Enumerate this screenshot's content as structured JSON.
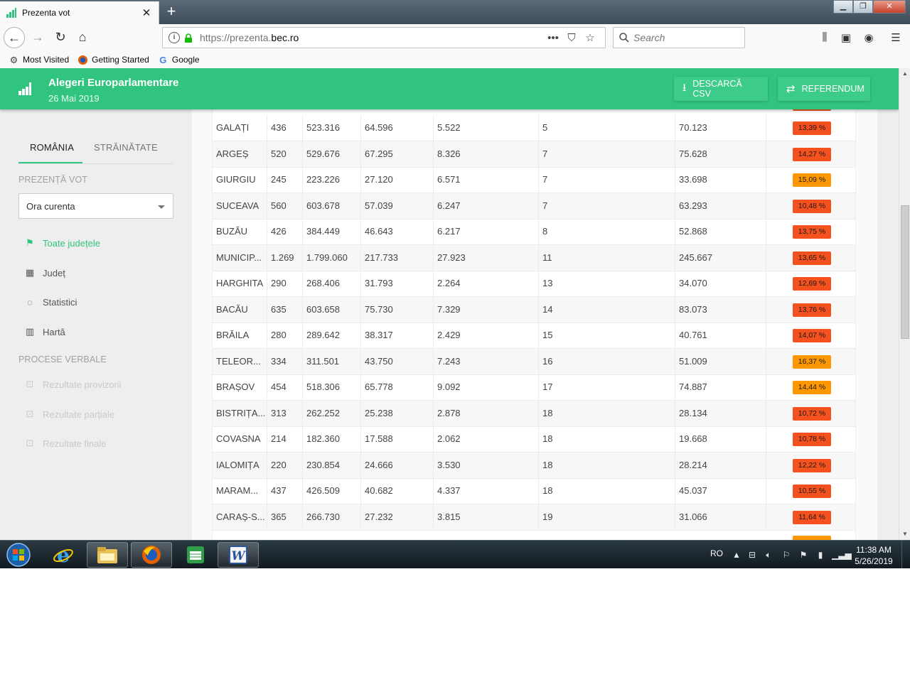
{
  "browser": {
    "tab_title": "Prezenta vot",
    "tab_close": "✕",
    "new_tab": "+",
    "url_prefix": "https://prezenta.",
    "url_domain": "bec.ro",
    "search_placeholder": "Search"
  },
  "bookmarks": [
    {
      "label": "Most Visited",
      "icon": "gear-icon"
    },
    {
      "label": "Getting Started",
      "icon": "firefox-icon"
    },
    {
      "label": "Google",
      "icon": "google-icon"
    }
  ],
  "app": {
    "title": "Alegeri Europarlamentare",
    "date": "26 Mai 2019",
    "csv_label": "DESCARCĂ CSV",
    "referendum_label": "REFERENDUM",
    "accent_color": "#31c47f"
  },
  "sidebar": {
    "tab_romania": "ROMÂNIA",
    "tab_strainatate": "STRĂINĂTATE",
    "heading_prezenta": "PREZENȚĂ VOT",
    "select_value": "Ora curenta",
    "items": [
      {
        "label": "Toate județele",
        "icon": "flag-icon",
        "state": "active"
      },
      {
        "label": "Județ",
        "icon": "building-icon",
        "state": "normal"
      },
      {
        "label": "Statistici",
        "icon": "donut-chart-icon",
        "state": "normal"
      },
      {
        "label": "Hartă",
        "icon": "map-icon",
        "state": "normal"
      }
    ],
    "heading_procese": "PROCESE VERBALE",
    "results": [
      {
        "label": "Rezultate provizorii",
        "icon": "document-1-icon",
        "state": "disabled"
      },
      {
        "label": "Rezultate parțiale",
        "icon": "document-2-icon",
        "state": "disabled"
      },
      {
        "label": "Rezultate finale",
        "icon": "document-3-icon",
        "state": "disabled"
      }
    ]
  },
  "table": {
    "rows": [
      {
        "judet": "GALAȚI",
        "c1": "436",
        "c2": "523.316",
        "c3": "64.596",
        "c4": "5.522",
        "c5": "5",
        "c6": "70.123",
        "pct": "13,39 %",
        "level": "red"
      },
      {
        "judet": "ARGEȘ",
        "c1": "520",
        "c2": "529.676",
        "c3": "67.295",
        "c4": "8.326",
        "c5": "7",
        "c6": "75.628",
        "pct": "14,27 %",
        "level": "red"
      },
      {
        "judet": "GIURGIU",
        "c1": "245",
        "c2": "223.226",
        "c3": "27.120",
        "c4": "6.571",
        "c5": "7",
        "c6": "33.698",
        "pct": "15,09 %",
        "level": "orange"
      },
      {
        "judet": "SUCEAVA",
        "c1": "560",
        "c2": "603.678",
        "c3": "57.039",
        "c4": "6.247",
        "c5": "7",
        "c6": "63.293",
        "pct": "10,48 %",
        "level": "red"
      },
      {
        "judet": "BUZĂU",
        "c1": "426",
        "c2": "384.449",
        "c3": "46.643",
        "c4": "6.217",
        "c5": "8",
        "c6": "52.868",
        "pct": "13,75 %",
        "level": "red"
      },
      {
        "judet": "MUNICIP...",
        "c1": "1.269",
        "c2": "1.799.060",
        "c3": "217.733",
        "c4": "27.923",
        "c5": "11",
        "c6": "245.667",
        "pct": "13,65 %",
        "level": "red"
      },
      {
        "judet": "HARGHITA",
        "c1": "290",
        "c2": "268.406",
        "c3": "31.793",
        "c4": "2.264",
        "c5": "13",
        "c6": "34.070",
        "pct": "12,69 %",
        "level": "red"
      },
      {
        "judet": "BACĂU",
        "c1": "635",
        "c2": "603.658",
        "c3": "75.730",
        "c4": "7.329",
        "c5": "14",
        "c6": "83.073",
        "pct": "13,76 %",
        "level": "red"
      },
      {
        "judet": "BRĂILA",
        "c1": "280",
        "c2": "289.642",
        "c3": "38.317",
        "c4": "2.429",
        "c5": "15",
        "c6": "40.761",
        "pct": "14,07 %",
        "level": "red"
      },
      {
        "judet": "TELEOR...",
        "c1": "334",
        "c2": "311.501",
        "c3": "43.750",
        "c4": "7.243",
        "c5": "16",
        "c6": "51.009",
        "pct": "16,37 %",
        "level": "orange"
      },
      {
        "judet": "BRAȘOV",
        "c1": "454",
        "c2": "518.306",
        "c3": "65.778",
        "c4": "9.092",
        "c5": "17",
        "c6": "74.887",
        "pct": "14,44 %",
        "level": "orange"
      },
      {
        "judet": "BISTRIȚA...",
        "c1": "313",
        "c2": "262.252",
        "c3": "25.238",
        "c4": "2.878",
        "c5": "18",
        "c6": "28.134",
        "pct": "10,72 %",
        "level": "red"
      },
      {
        "judet": "COVASNA",
        "c1": "214",
        "c2": "182.360",
        "c3": "17.588",
        "c4": "2.062",
        "c5": "18",
        "c6": "19.668",
        "pct": "10,78 %",
        "level": "red"
      },
      {
        "judet": "IALOMIȚA",
        "c1": "220",
        "c2": "230.854",
        "c3": "24.666",
        "c4": "3.530",
        "c5": "18",
        "c6": "28.214",
        "pct": "12,22 %",
        "level": "red"
      },
      {
        "judet": "MARAM...",
        "c1": "437",
        "c2": "426.509",
        "c3": "40.682",
        "c4": "4.337",
        "c5": "18",
        "c6": "45.037",
        "pct": "10,55 %",
        "level": "red"
      },
      {
        "judet": "CARAȘ-S...",
        "c1": "365",
        "c2": "266.730",
        "c3": "27.232",
        "c4": "3.815",
        "c5": "19",
        "c6": "31.066",
        "pct": "11,64 %",
        "level": "red"
      }
    ],
    "colors": {
      "red": "#f4511e",
      "orange": "#ff9800"
    }
  },
  "taskbar": {
    "apps": [
      {
        "name": "internet-explorer-icon"
      },
      {
        "name": "file-explorer-icon"
      },
      {
        "name": "firefox-icon"
      },
      {
        "name": "spreadsheet-icon"
      },
      {
        "name": "word-icon"
      }
    ],
    "lang": "RO",
    "time": "11:38 AM",
    "date": "5/26/2019"
  }
}
